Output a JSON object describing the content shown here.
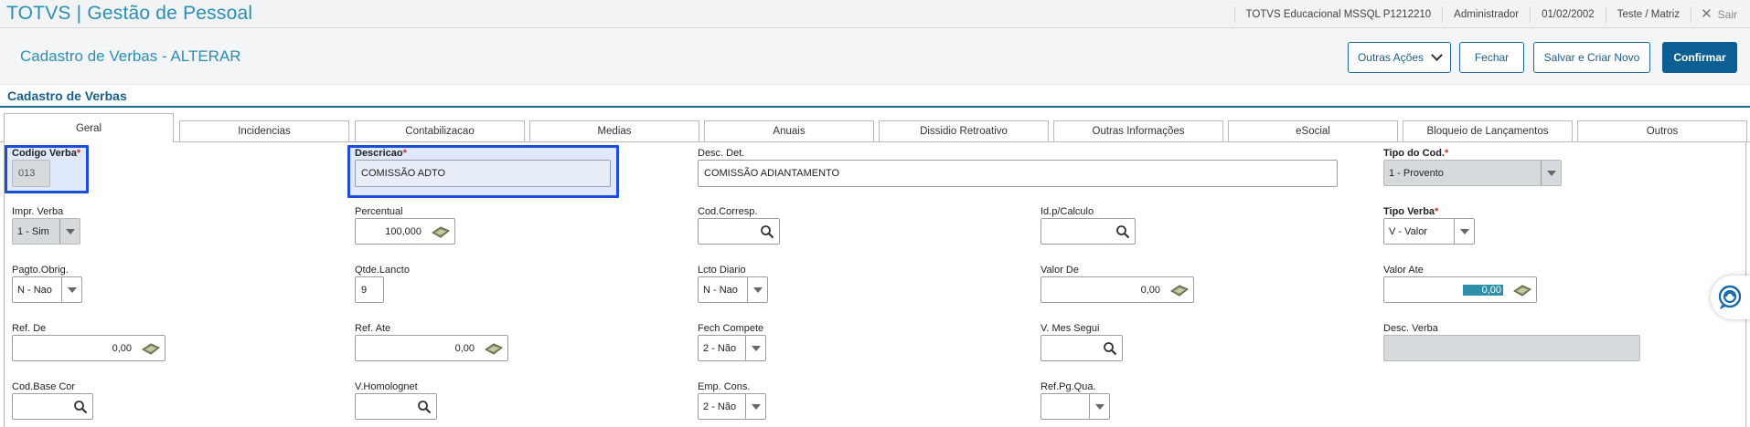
{
  "app": {
    "brand": "TOTVS | Gestão de Pessoal"
  },
  "topbar": {
    "environment": "TOTVS Educacional MSSQL P1212210",
    "user": "Administrador",
    "date": "01/02/2002",
    "branch": "Teste / Matriz",
    "exit_label": "Sair"
  },
  "header": {
    "title": "Cadastro de Verbas - ALTERAR",
    "other_actions_label": "Outras Ações",
    "close_label": "Fechar",
    "save_new_label": "Salvar e Criar Novo",
    "confirm_label": "Confirmar"
  },
  "section": {
    "title": "Cadastro de Verbas"
  },
  "tabs": [
    {
      "label": "Geral",
      "active": true
    },
    {
      "label": "Incidencias"
    },
    {
      "label": "Contabilizacao"
    },
    {
      "label": "Medias"
    },
    {
      "label": "Anuais"
    },
    {
      "label": "Dissidio Retroativo"
    },
    {
      "label": "Outras Informações"
    },
    {
      "label": "eSocial"
    },
    {
      "label": "Bloqueio de Lançamentos"
    },
    {
      "label": "Outros"
    }
  ],
  "required_mark": "*",
  "fields": {
    "codigo_verba": {
      "label": "Codigo Verba",
      "value": "013"
    },
    "descricao": {
      "label": "Descricao",
      "value": "COMISSÃO ADTO"
    },
    "desc_det": {
      "label": "Desc. Det.",
      "value": "COMISSÃO ADIANTAMENTO"
    },
    "tipo_cod": {
      "label": "Tipo do Cod.",
      "value": "1 - Provento"
    },
    "impr_verba": {
      "label": "Impr. Verba",
      "value": "1 - Sim"
    },
    "percentual": {
      "label": "Percentual",
      "value": "100,000"
    },
    "cod_corresp": {
      "label": "Cod.Corresp.",
      "value": ""
    },
    "id_calculo": {
      "label": "Id.p/Calculo",
      "value": ""
    },
    "tipo_verba": {
      "label": "Tipo Verba",
      "value": "V - Valor"
    },
    "pagto_obrig": {
      "label": "Pagto.Obrig.",
      "value": "N - Nao"
    },
    "qtde_lancto": {
      "label": "Qtde.Lancto",
      "value": "9"
    },
    "lcto_diario": {
      "label": "Lcto Diario",
      "value": "N - Nao"
    },
    "valor_de": {
      "label": "Valor De",
      "value": "0,00"
    },
    "valor_ate": {
      "label": "Valor Ate",
      "value": "0,00"
    },
    "ref_de": {
      "label": "Ref. De",
      "value": "0,00"
    },
    "ref_ate": {
      "label": "Ref. Ate",
      "value": "0,00"
    },
    "fech_compete": {
      "label": "Fech Compete",
      "value": "2 - Não"
    },
    "v_mes_segui": {
      "label": "V. Mes Segui",
      "value": ""
    },
    "desc_verba": {
      "label": "Desc. Verba",
      "value": ""
    },
    "cod_base_cor": {
      "label": "Cod.Base Cor",
      "value": ""
    },
    "v_homolognet": {
      "label": "V.Homolognet",
      "value": ""
    },
    "emp_cons": {
      "label": "Emp. Cons.",
      "value": "2 - Não"
    },
    "ref_pg_qua": {
      "label": "Ref.Pg.Qua.",
      "value": ""
    }
  },
  "colors": {
    "brand": "#2a8fb5",
    "primary": "#0c5f93",
    "highlight": "#1a4ed8",
    "required": "#d9262a"
  },
  "icons": {
    "lookup": "magnifier-icon",
    "calculator": "calculator-icon",
    "dropdown": "chevron-down-icon",
    "close": "close-icon",
    "chat": "chat-bubble-icon"
  }
}
